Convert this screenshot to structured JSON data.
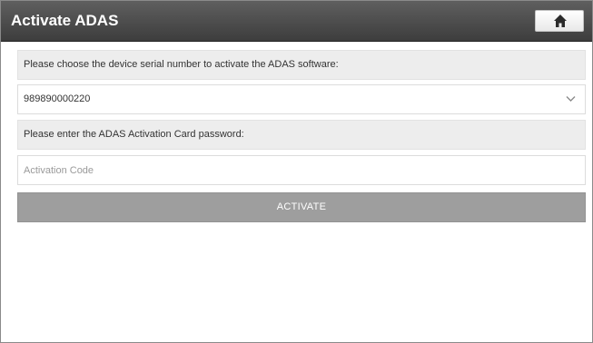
{
  "header": {
    "title": "Activate ADAS",
    "home_icon": "home-icon"
  },
  "serial_section": {
    "prompt": "Please choose the device serial number to activate the ADAS software:",
    "selected_serial": "989890000220",
    "dropdown_icon": "chevron-down-icon"
  },
  "password_section": {
    "prompt": "Please enter the ADAS Activation Card password:",
    "placeholder": "Activation Code",
    "value": ""
  },
  "actions": {
    "activate_label": "ACTIVATE"
  }
}
